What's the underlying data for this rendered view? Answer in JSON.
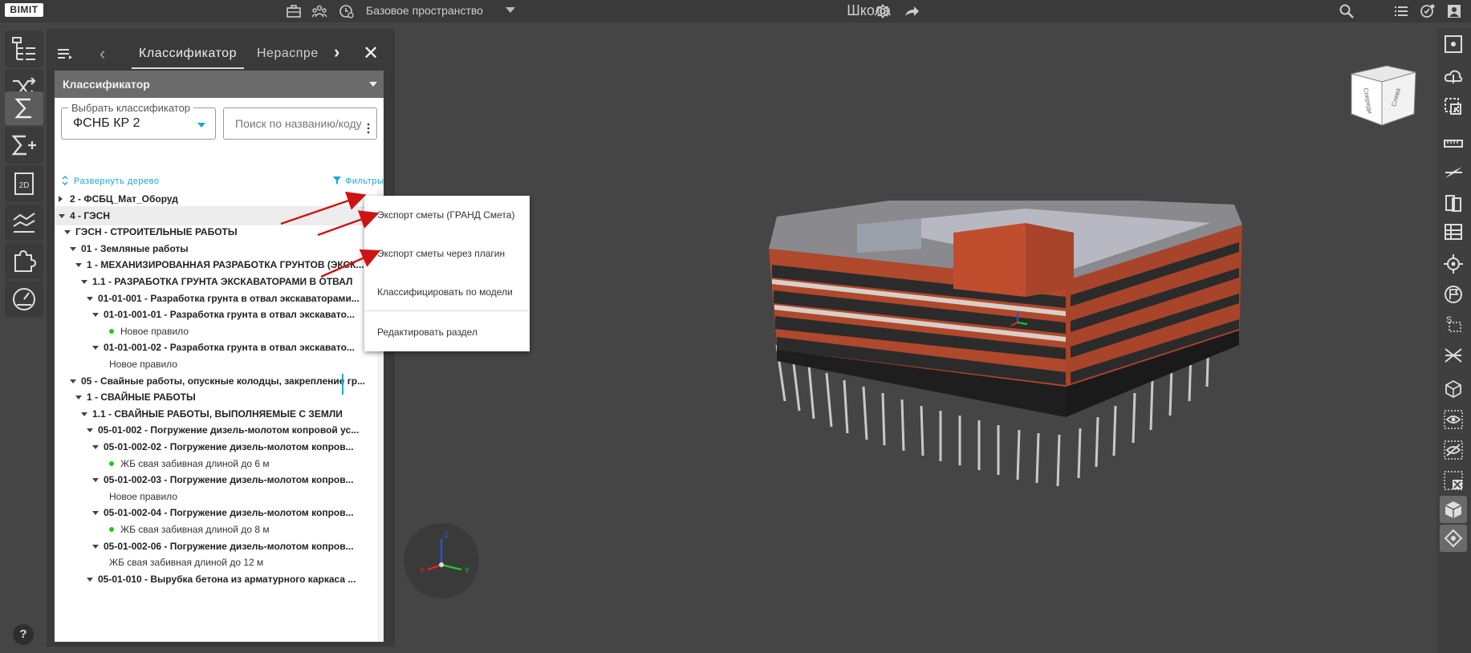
{
  "topbar": {
    "logo": "BIMIT",
    "space": "Базовое пространство",
    "project_title": "Школа",
    "icons": [
      "briefcase-icon",
      "team-icon",
      "clock-settings-icon",
      "gear-icon",
      "share-icon",
      "search-icon",
      "list-icon",
      "notifications-icon",
      "account-icon"
    ]
  },
  "left_rail": {
    "items": [
      "tree-icon",
      "shuffle-icon",
      "sum-icon",
      "sum-plus-icon",
      "2d-icon",
      "chart-lines-icon",
      "puzzle-icon",
      "gauge-icon"
    ],
    "labels": {
      "plan2d": "2D"
    },
    "help": "?"
  },
  "panel": {
    "tabs": {
      "classifier": "Классификатор",
      "unassigned": "Нераспре"
    },
    "header": "Классификатор",
    "select_label": "Выбрать классификатор",
    "select_value": "ФСНБ КР 2",
    "search_placeholder": "Поиск по названию/коду",
    "expand_tree": "Развернуть дерево",
    "filters": "Фильтры"
  },
  "tree": [
    {
      "label": "2 - ФСБЦ_Мат_Оборуд"
    },
    {
      "label": "4 - ГЭСН"
    },
    {
      "label": "ГЭСН - СТРОИТЕЛЬНЫЕ РАБОТЫ"
    },
    {
      "label": "01 - Земляные работы"
    },
    {
      "label": "1 - МЕХАНИЗИРОВАННАЯ РАЗРАБОТКА ГРУНТОВ (ЭКСК..."
    },
    {
      "label": "1.1 - РАЗРАБОТКА ГРУНТА ЭКСКАВАТОРАМИ В ОТВАЛ"
    },
    {
      "label": "01-01-001 - Разработка грунта в отвал экскаваторами..."
    },
    {
      "label": "01-01-001-01 - Разработка грунта в отвал экскавато..."
    },
    {
      "label": "Новое правило"
    },
    {
      "label": "01-01-001-02 - Разработка грунта в отвал экскавато..."
    },
    {
      "label": "Новое правило"
    },
    {
      "label": "05 - Свайные работы, опускные колодцы, закрепление гр..."
    },
    {
      "label": "1 - СВАЙНЫЕ РАБОТЫ"
    },
    {
      "label": "1.1 - СВАЙНЫЕ РАБОТЫ, ВЫПОЛНЯЕМЫЕ С ЗЕМЛИ"
    },
    {
      "label": "05-01-002 - Погружение дизель-молотом копровой ус..."
    },
    {
      "label": "05-01-002-02 - Погружение дизель-молотом копров..."
    },
    {
      "label": "ЖБ свая забивная длиной до 6 м"
    },
    {
      "label": "05-01-002-03 - Погружение дизель-молотом копров..."
    },
    {
      "label": "Новое правило"
    },
    {
      "label": "05-01-002-04 - Погружение дизель-молотом копров..."
    },
    {
      "label": "ЖБ свая забивная длиной до 8 м"
    },
    {
      "label": "05-01-002-06 - Погружение дизель-молотом копров..."
    },
    {
      "label": "ЖБ свая забивная длиной до 12 м"
    },
    {
      "label": "05-01-010 - Вырубка бетона из арматурного каркаса ..."
    }
  ],
  "context_menu": {
    "items": [
      "Экспорт сметы (ГРАНД Смета)",
      "Экспорт сметы через плагин",
      "Классифицировать по модели",
      "Редактировать раздел"
    ]
  },
  "viewport": {
    "viewcube_faces": [
      "Спереди",
      "Слева"
    ],
    "gizmo_axes": [
      "Z",
      "Y",
      "X"
    ]
  },
  "right_rail": {
    "items": [
      "fit-view-icon",
      "cloud-icon",
      "select-area-icon",
      "ruler-icon",
      "section-icon",
      "layers-icon",
      "grid-icon",
      "target-icon",
      "flag-icon",
      "select-dimension-icon",
      "crossing-icon",
      "cube-icon",
      "eye-icon",
      "eye-off-icon",
      "clear-selection-icon",
      "box-view-icon",
      "orbit-icon"
    ]
  },
  "colors": {
    "accent": "#1aa7d6",
    "status_green": "#1ec81e",
    "annotation_red": "#cc1414"
  }
}
